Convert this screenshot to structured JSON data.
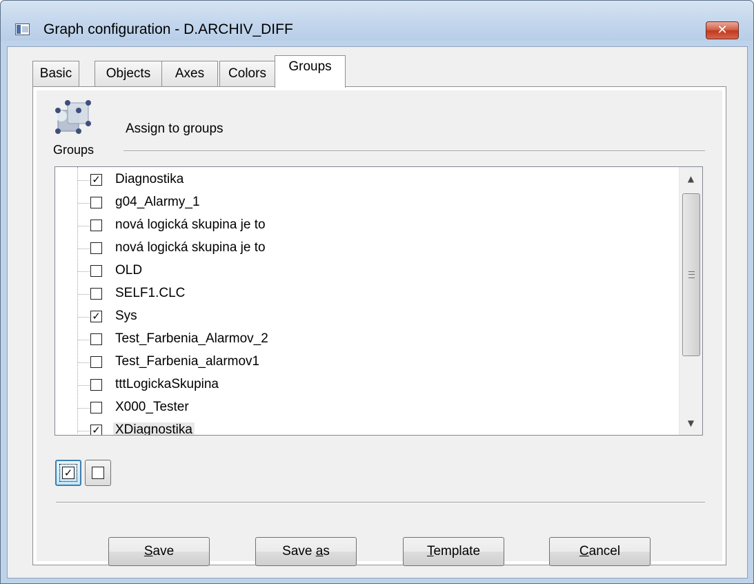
{
  "window": {
    "title": "Graph configuration -  D.ARCHIV_DIFF",
    "close_glyph": "✕",
    "app_icon": "window-app-icon"
  },
  "tabs": [
    {
      "label": "Basic",
      "active": false
    },
    {
      "label": "Objects",
      "active": false
    },
    {
      "label": "Axes",
      "active": false
    },
    {
      "label": "Colors",
      "active": false
    },
    {
      "label": "Groups",
      "active": true
    }
  ],
  "groups_panel": {
    "icon": "groups-icon",
    "icon_caption": "Groups",
    "heading": "Assign to groups",
    "items": [
      {
        "label": "Diagnostika",
        "checked": true
      },
      {
        "label": "g04_Alarmy_1",
        "checked": false
      },
      {
        "label": "nová logická skupina je to",
        "checked": false
      },
      {
        "label": "nová logická skupina je to",
        "checked": false
      },
      {
        "label": "OLD",
        "checked": false
      },
      {
        "label": "SELF1.CLC",
        "checked": false
      },
      {
        "label": "Sys",
        "checked": true
      },
      {
        "label": "Test_Farbenia_Alarmov_2",
        "checked": false
      },
      {
        "label": "Test_Farbenia_alarmov1",
        "checked": false
      },
      {
        "label": "tttLogickaSkupina",
        "checked": false
      },
      {
        "label": "X000_Tester",
        "checked": false
      },
      {
        "label": "XDiagnostika",
        "checked": true,
        "selected": true
      }
    ],
    "check_all_glyph": "✓",
    "uncheck_all_glyph": ""
  },
  "buttons": {
    "save": {
      "pre": "",
      "mnemonic": "S",
      "post": "ave"
    },
    "save_as": {
      "pre": "Save ",
      "mnemonic": "a",
      "post": "s"
    },
    "template": {
      "pre": "",
      "mnemonic": "T",
      "post": "emplate"
    },
    "cancel": {
      "pre": "",
      "mnemonic": "C",
      "post": "ancel"
    }
  },
  "colors": {
    "frame": "#bed3ea",
    "face": "#f0f0f0",
    "close_red": "#c0381f",
    "focus_blue": "#3c7fb1"
  }
}
